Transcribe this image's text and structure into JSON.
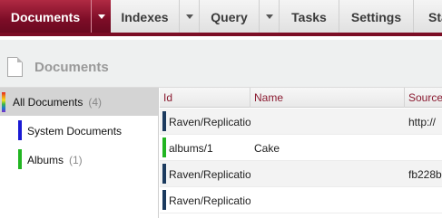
{
  "tabs": [
    {
      "label": "Documents",
      "active": true
    },
    {
      "label": "Indexes"
    },
    {
      "label": "Query"
    },
    {
      "label": "Tasks"
    },
    {
      "label": "Settings"
    },
    {
      "label": "Sta"
    }
  ],
  "header": {
    "title": "Documents",
    "icon": "document-icon"
  },
  "sidebar": {
    "items": [
      {
        "label": "All Documents",
        "count": "(4)",
        "color": "rainbow"
      },
      {
        "label": "System Documents",
        "count": "",
        "color": "#1a1ad4"
      },
      {
        "label": "Albums",
        "count": "(1)",
        "color": "#22b522"
      }
    ]
  },
  "table": {
    "columns": [
      "Id",
      "Name",
      "Source"
    ],
    "rows": [
      {
        "id": "Raven/Replication",
        "name": "",
        "source": "http://",
        "color": "#1b3a5e"
      },
      {
        "id": "albums/1",
        "name": "Cake",
        "source": "",
        "color": "#22b522"
      },
      {
        "id": "Raven/Replication",
        "name": "",
        "source": "fb228b",
        "color": "#1b3a5e"
      },
      {
        "id": "Raven/Replication",
        "name": "",
        "source": "",
        "color": "#1b3a5e"
      }
    ]
  },
  "colors": {
    "accent": "#7d0d27",
    "header_text": "#8a1a30"
  }
}
